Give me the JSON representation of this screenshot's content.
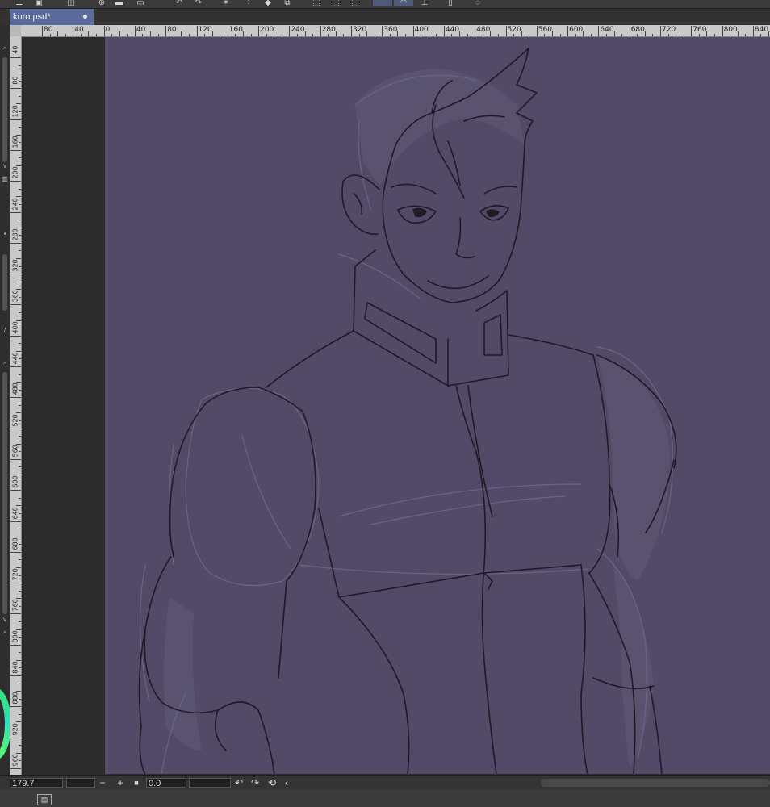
{
  "toolbar": {
    "icons": [
      "menu-icon",
      "save-icon",
      "camera-icon",
      "add-layer-icon",
      "folder-icon",
      "window-icon",
      "undo-icon",
      "redo-icon",
      "sparkle-icon",
      "dots-icon",
      "fill-icon",
      "transform-icon",
      "selection-icon",
      "lasso-icon",
      "ruler-icon",
      "phone-icon",
      "speech-icon"
    ]
  },
  "document_tab": {
    "label": "kuro.psd*"
  },
  "rulers": {
    "horizontal_labels": [
      "80",
      "40",
      "0",
      "40",
      "80",
      "120",
      "160",
      "200",
      "240",
      "280",
      "320",
      "360",
      "400",
      "440",
      "480",
      "520",
      "560",
      "600",
      "640",
      "680",
      "720",
      "760",
      "800",
      "840"
    ],
    "vertical_labels": [
      "40",
      "80",
      "120",
      "160",
      "200",
      "240",
      "280",
      "320",
      "360",
      "400",
      "440",
      "480",
      "520",
      "560",
      "600",
      "640",
      "680",
      "720",
      "760",
      "800",
      "840",
      "880",
      "920",
      "960"
    ]
  },
  "status": {
    "zoom": "179.7",
    "rotation": "0.0",
    "zoom_out_symbol": "−",
    "zoom_in_symbol": "+",
    "fit_symbol": "■",
    "rotate_left_symbol": "↶",
    "rotate_right_symbol": "↷",
    "reset_symbol": "⟲",
    "scroll_left_symbol": "‹"
  },
  "colors": {
    "canvas": "#524a66",
    "sketch_line": "#1e1a26",
    "sketch_light": "#6b6485",
    "tab_active": "#5a6a9a",
    "color_wheel_accent": "#36e27a"
  }
}
